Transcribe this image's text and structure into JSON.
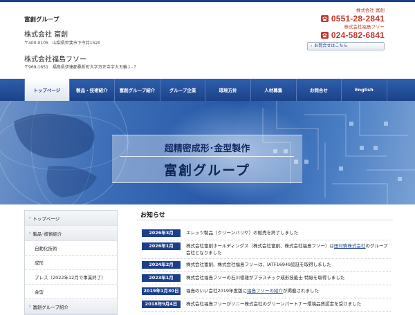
{
  "header": {
    "group_name": "富創グループ",
    "company1": {
      "name": "株式会社 富創",
      "address": "〒400-0105　山梨県甲斐市下今井1520"
    },
    "company2": {
      "name": "株式会社福島フソー",
      "address": "〒969-1651　福島県伊達郡桑折町大字万正寺字大五輪１-７"
    },
    "contact": [
      {
        "company": "株式会社 富創",
        "tel": "0551-28-2841"
      },
      {
        "company": "株式会社福島フソー",
        "tel": "024-582-6841"
      }
    ],
    "inquiry_button": "お問合せはこちら",
    "accent_color": "#c0392b"
  },
  "nav": {
    "items": [
      {
        "label": "トップページ",
        "active": true
      },
      {
        "label": "製品・技術紹介"
      },
      {
        "label": "富創グループ紹介"
      },
      {
        "label": "グループ企業"
      },
      {
        "label": "環境方針"
      },
      {
        "label": "人材募集"
      },
      {
        "label": "お問合せ"
      },
      {
        "label": "English"
      }
    ],
    "color": "#1c3f8c"
  },
  "hero": {
    "subtitle": "超精密成形･金型製作",
    "title": "富創グループ"
  },
  "sidebar": {
    "items": [
      {
        "label": "トップページ",
        "type": "main"
      },
      {
        "label": "製品･技術紹介",
        "type": "main"
      },
      {
        "label": "自動化技術",
        "type": "sub"
      },
      {
        "label": "成形",
        "type": "sub"
      },
      {
        "label": "プレス（2022年12月で事業終了）",
        "type": "sub"
      },
      {
        "label": "金型",
        "type": "sub"
      },
      {
        "label": "富創グループ紹介",
        "type": "main"
      }
    ]
  },
  "news": {
    "title": "お知らせ",
    "items": [
      {
        "date": "2026年3月",
        "text": "エレッツ製品（クリーンバリヤ）の販売を終了しました"
      },
      {
        "date": "2026年1月",
        "text_before": "株式会社富創ホールディングス（株式会社富創、株式会社福島フソー）は",
        "link": "田村駒株式会社",
        "text_after": "のグループ会社となりました"
      },
      {
        "date": "2024年2月",
        "text": "株式会社富創、株式会社福島フソーは、IATF16949認証を取得しました"
      },
      {
        "date": "2023年1月",
        "text": "株式会社福島フソーの石川徳雄がプラスチック成形技能士 特級を取得しました"
      },
      {
        "date": "2019年1月30日",
        "text_before": "福島のいい会社2019年度版に",
        "link": "福島フソーの紹介",
        "text_after": "が掲載されました"
      },
      {
        "date": "2018年9月4日",
        "text": "株式会社福島フソーがソニー株式会社のグリーンパートナー環境品質認定を受けました"
      }
    ]
  }
}
